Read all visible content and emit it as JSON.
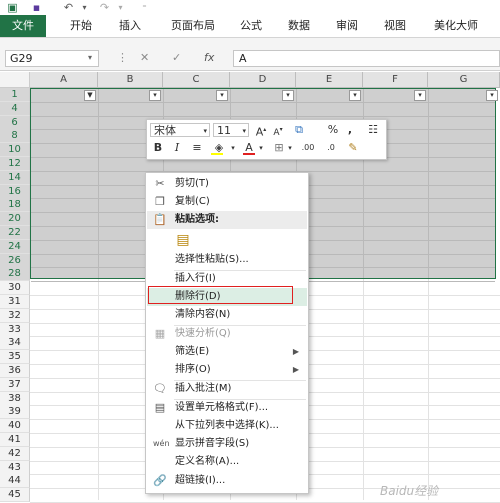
{
  "ribbon": {
    "tabs": [
      "文件",
      "开始",
      "插入",
      "页面布局",
      "公式",
      "数据",
      "审阅",
      "视图",
      "美化大师"
    ]
  },
  "formula_bar": {
    "cell_ref": "G29",
    "content": "A",
    "fx": "fx"
  },
  "columns": [
    "A",
    "B",
    "C",
    "D",
    "E",
    "F",
    "G"
  ],
  "rows": [
    "1",
    "4",
    "6",
    "8",
    "10",
    "12",
    "14",
    "16",
    "18",
    "20",
    "22",
    "24",
    "26",
    "28",
    "30",
    "31",
    "32",
    "33",
    "34",
    "35",
    "36",
    "37",
    "38",
    "39",
    "40",
    "41",
    "42",
    "43",
    "44",
    "45"
  ],
  "mini_toolbar": {
    "font_name": "宋体",
    "font_size": "11",
    "percent": "%",
    "comma": ",",
    "bold": "B",
    "italic": "I",
    "inc_decimal": ".00",
    "dec_decimal": ".0"
  },
  "context_menu": {
    "cut": "剪切(T)",
    "copy": "复制(C)",
    "paste_options": "粘贴选项:",
    "paste_special": "选择性粘贴(S)...",
    "insert_row": "插入行(I)",
    "delete_row": "删除行(D)",
    "clear_contents": "清除内容(N)",
    "quick_analysis": "快速分析(Q)",
    "filter": "筛选(E)",
    "sort": "排序(O)",
    "insert_comment": "插入批注(M)",
    "format_cells": "设置单元格格式(F)...",
    "pick_from_list": "从下拉列表中选择(K)...",
    "phonetic": "显示拼音字段(S)",
    "define_name": "定义名称(A)...",
    "hyperlink": "超链接(I)..."
  },
  "watermark": "Baidu经验"
}
